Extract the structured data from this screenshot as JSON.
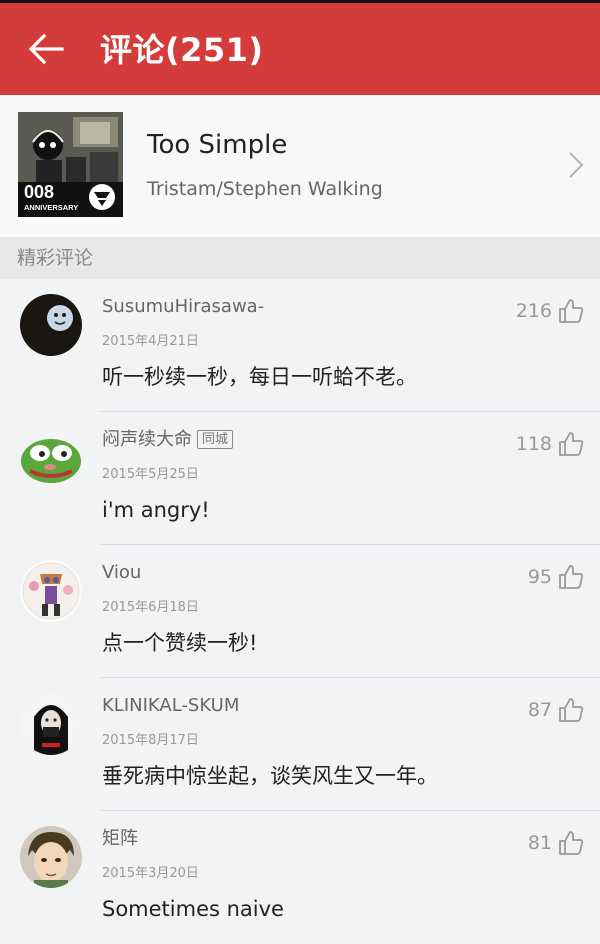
{
  "app_bar": {
    "title": "评论(251)"
  },
  "song": {
    "title": "Too Simple",
    "artist": "Tristam/Stephen Walking",
    "cover_text_number": "008",
    "cover_text_label": "ANNIVERSARY"
  },
  "section": {
    "title": "精彩评论"
  },
  "comments": [
    {
      "username": "SusumuHirasawa-",
      "tag": "",
      "date": "2015年4月21日",
      "text": "听一秒续一秒，每日一听蛤不老。",
      "likes": "216"
    },
    {
      "username": "闷声续大命",
      "tag": "同城",
      "date": "2015年5月25日",
      "text": "i'm angry!",
      "likes": "118"
    },
    {
      "username": "Viou",
      "tag": "",
      "date": "2015年6月18日",
      "text": "点一个赞续一秒!",
      "likes": "95"
    },
    {
      "username": "KLINIKAL-SKUM",
      "tag": "",
      "date": "2015年8月17日",
      "text": "垂死病中惊坐起，谈笑风生又一年。",
      "likes": "87"
    },
    {
      "username": "矩阵",
      "tag": "",
      "date": "2015年3月20日",
      "text": "Sometimes naive",
      "likes": "81"
    }
  ],
  "colors": {
    "app_bar": "#d43c3c",
    "background": "#f2f3f5",
    "section_header": "#e6e7e9"
  },
  "icons": {
    "back": "arrow-left-icon",
    "chevron": "chevron-right-icon",
    "like": "thumbs-up-icon"
  }
}
